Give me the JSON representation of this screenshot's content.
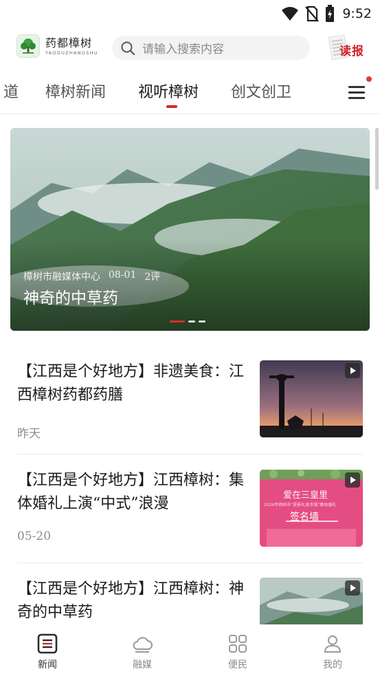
{
  "status_bar": {
    "time": "9:52",
    "icons": [
      "wifi-icon",
      "no-sim-icon",
      "battery-icon"
    ]
  },
  "header": {
    "logo_cn": "药都樟树",
    "logo_en": "YAODUZHANGSHU",
    "search_placeholder": "请输入搜索内容",
    "read_paper_label": "读报"
  },
  "tabs": [
    {
      "label": "道",
      "active": false
    },
    {
      "label": "樟树新闻",
      "active": false
    },
    {
      "label": "视听樟树",
      "active": true
    },
    {
      "label": "创文创卫",
      "active": false
    }
  ],
  "banner": {
    "source": "樟树市融媒体中心",
    "date": "08-01",
    "comments": "2评",
    "title": "神奇的中草药",
    "slide_count": 3,
    "active_slide": 1
  },
  "news": [
    {
      "title": "【江西是个好地方】非遗美食：江西樟树药都药膳",
      "date": "昨天",
      "thumb": "sunset-statue"
    },
    {
      "title": "【江西是个好地方】江西樟树：集体婚礼上演“中式”浪漫",
      "date": "05-20",
      "thumb": "wedding-wall"
    },
    {
      "title": "【江西是个好地方】江西樟树：神奇的中草药",
      "date": "",
      "thumb": "misty-mountains"
    }
  ],
  "thumb_text": {
    "wall_line1": "爱在三皇里",
    "wall_line2": "2024年樟树市“夏影礼爱幸福”集体婚礼",
    "wall_sign": "签名墙"
  },
  "bottom_nav": [
    {
      "label": "新闻",
      "icon": "news-icon",
      "active": true
    },
    {
      "label": "融媒",
      "icon": "cloud-icon",
      "active": false
    },
    {
      "label": "便民",
      "icon": "grid-icon",
      "active": false
    },
    {
      "label": "我的",
      "icon": "user-icon",
      "active": false
    }
  ],
  "colors": {
    "accent": "#d8262f",
    "tab_active": "#1d1d1d",
    "muted": "#8c8c8c"
  }
}
